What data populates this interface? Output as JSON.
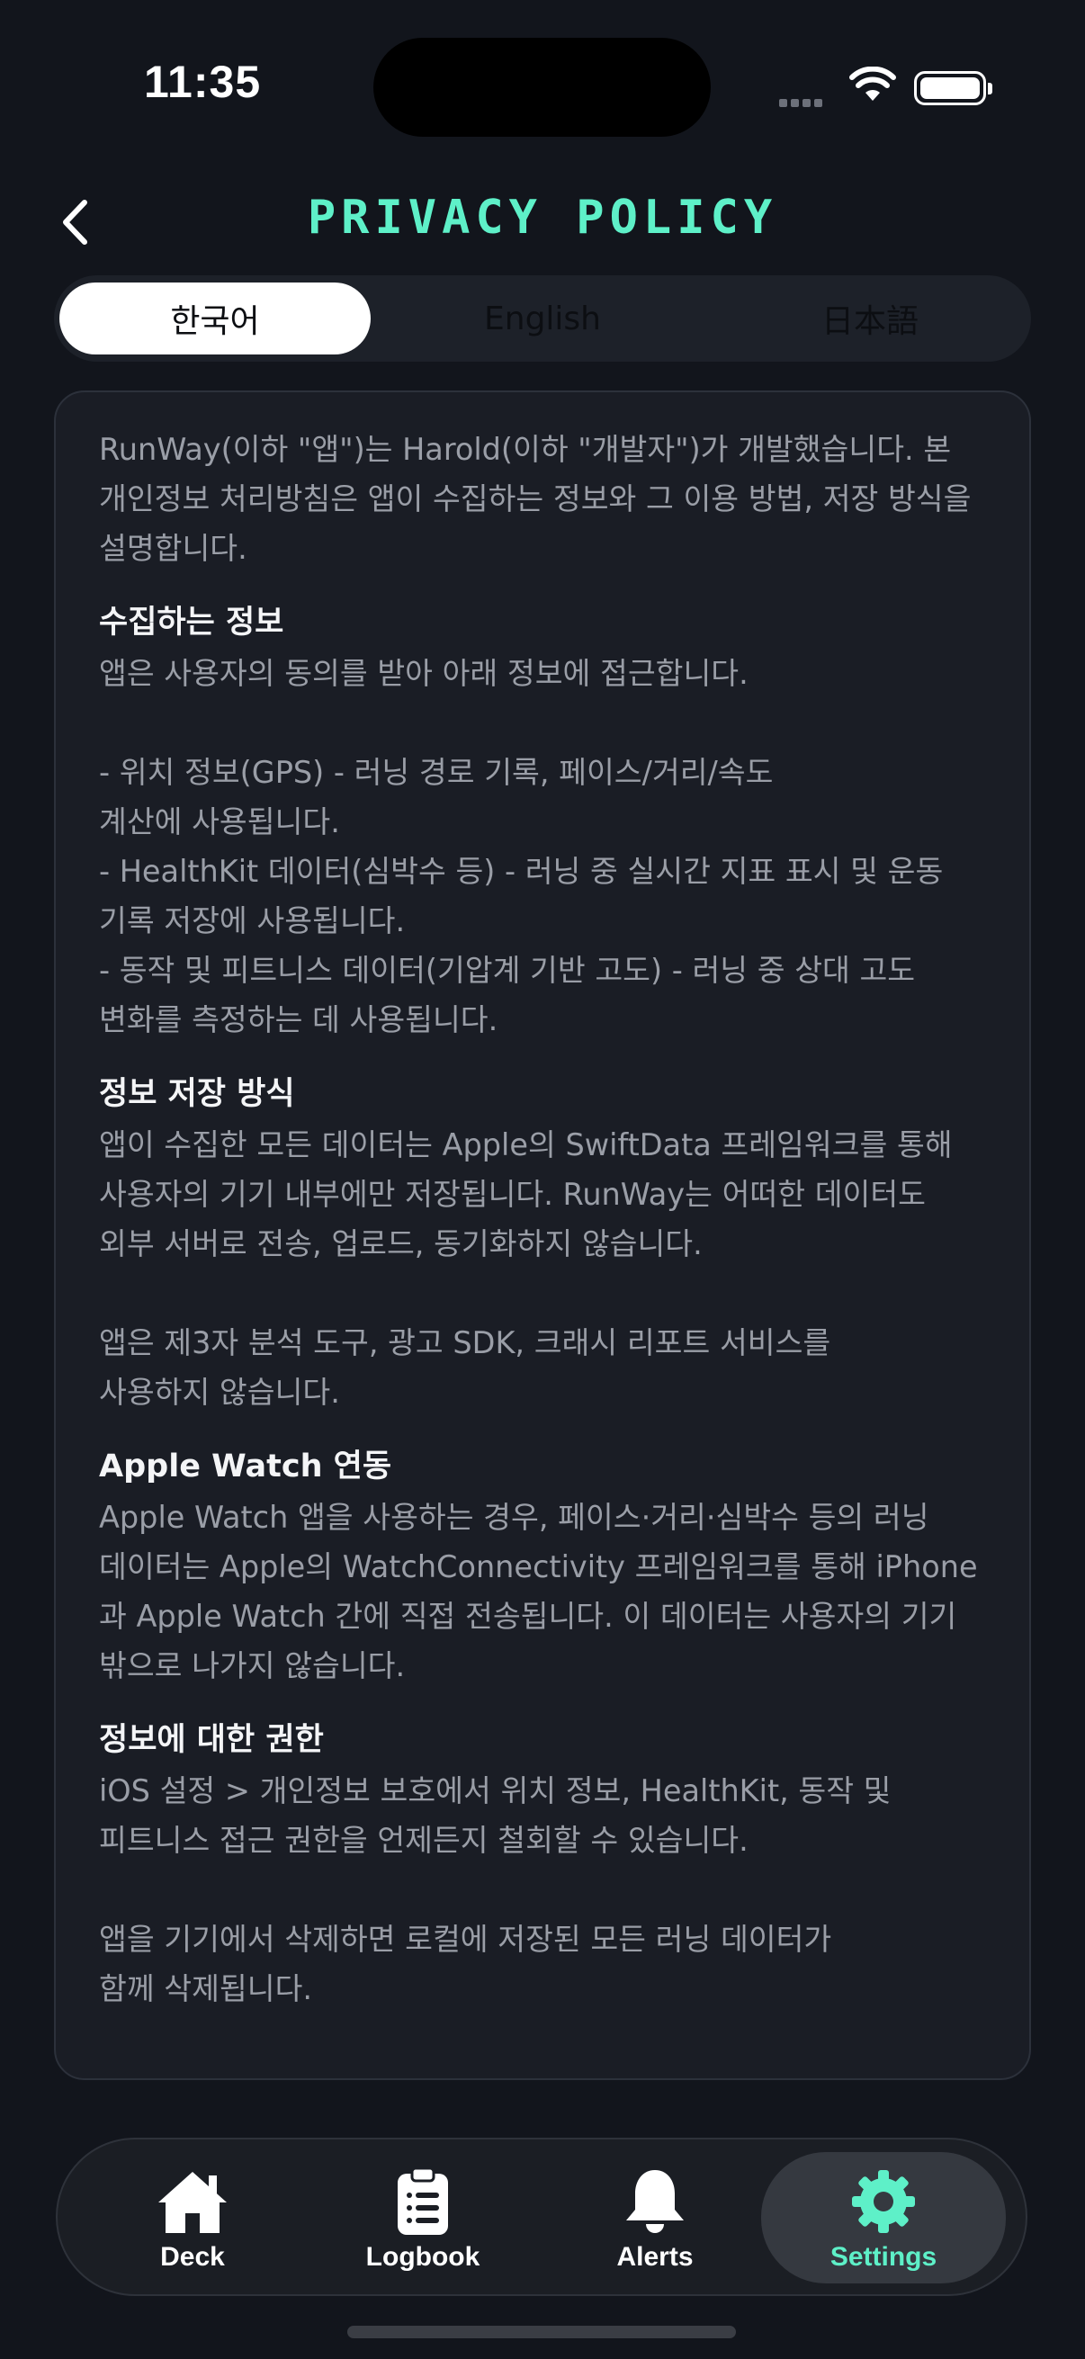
{
  "status": {
    "time": "11:35",
    "icons": [
      "cellular-icon",
      "wifi-icon",
      "battery-icon"
    ]
  },
  "nav": {
    "title": "PRIVACY POLICY",
    "back_icon": "chevron-left-icon"
  },
  "languages": [
    "한국어",
    "English",
    "日本語"
  ],
  "selected_language": "한국어",
  "policy": {
    "intro": "RunWay(이하 \"앱\")는 Harold(이하 \"개발자\")가 개발했습니다. 본\n개인정보 처리방침은 앱이 수집하는 정보와 그 이용 방법, 저장 방식을\n설명합니다.",
    "sections": [
      {
        "heading": "수집하는 정보",
        "body": "앱은 사용자의 동의를 받아 아래 정보에 접근합니다.\n\n- 위치 정보(GPS) - 러닝 경로 기록, 페이스/거리/속도\n계산에 사용됩니다.\n- HealthKit 데이터(심박수 등) - 러닝 중 실시간 지표 표시 및 운동\n기록 저장에 사용됩니다.\n- 동작 및 피트니스 데이터(기압계 기반 고도) - 러닝 중 상대 고도\n변화를 측정하는 데 사용됩니다."
      },
      {
        "heading": "정보 저장 방식",
        "body": "앱이 수집한 모든 데이터는 Apple의 SwiftData 프레임워크를 통해\n사용자의 기기 내부에만 저장됩니다. RunWay는 어떠한 데이터도\n외부 서버로 전송, 업로드, 동기화하지 않습니다.\n\n앱은 제3자 분석 도구, 광고 SDK, 크래시 리포트 서비스를\n사용하지 않습니다."
      },
      {
        "heading": "Apple Watch 연동",
        "body": "Apple Watch 앱을 사용하는 경우, 페이스·거리·심박수 등의 러닝\n데이터는 Apple의 WatchConnectivity 프레임워크를 통해 iPhone\n과 Apple Watch 간에 직접 전송됩니다. 이 데이터는 사용자의 기기\n밖으로 나가지 않습니다."
      },
      {
        "heading": "정보에 대한 권한",
        "body": "iOS 설정 > 개인정보 보호에서 위치 정보, HealthKit, 동작 및\n피트니스 접근 권한을 언제든지 철회할 수 있습니다.\n\n앱을 기기에서 삭제하면 로컬에 저장된 모든 러닝 데이터가\n함께 삭제됩니다."
      }
    ]
  },
  "tabs": [
    {
      "label": "Deck",
      "icon": "house-icon"
    },
    {
      "label": "Logbook",
      "icon": "clipboard-icon"
    },
    {
      "label": "Alerts",
      "icon": "bell-icon"
    },
    {
      "label": "Settings",
      "icon": "gear-icon"
    }
  ],
  "selected_tab": "Settings",
  "colors": {
    "accent": "#5ef0c8",
    "background": "#12151c",
    "card": "#1a1d25"
  }
}
